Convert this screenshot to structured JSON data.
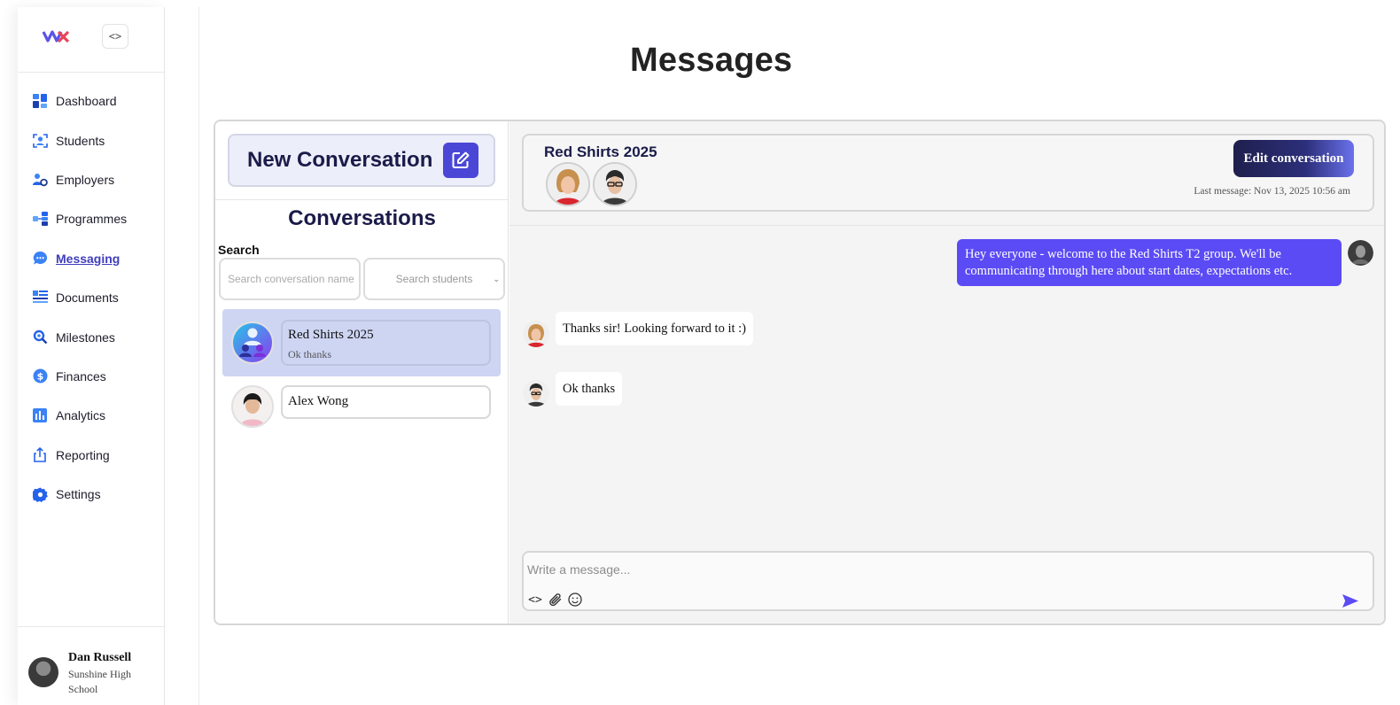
{
  "sidebar": {
    "collapse_label": "<>",
    "items": [
      {
        "label": "Dashboard",
        "icon": "dashboard-icon"
      },
      {
        "label": "Students",
        "icon": "students-icon"
      },
      {
        "label": "Employers",
        "icon": "employers-icon"
      },
      {
        "label": "Programmes",
        "icon": "programmes-icon"
      },
      {
        "label": "Messaging",
        "icon": "messaging-icon",
        "active": true
      },
      {
        "label": "Documents",
        "icon": "documents-icon"
      },
      {
        "label": "Milestones",
        "icon": "milestones-icon"
      },
      {
        "label": "Finances",
        "icon": "finances-icon"
      },
      {
        "label": "Analytics",
        "icon": "analytics-icon"
      },
      {
        "label": "Reporting",
        "icon": "reporting-icon"
      },
      {
        "label": "Settings",
        "icon": "settings-icon"
      }
    ],
    "user": {
      "name": "Dan Russell",
      "school": "Sunshine High School"
    }
  },
  "page": {
    "title": "Messages"
  },
  "left_pane": {
    "new_conversation_label": "New Conversation",
    "conversations_heading": "Conversations",
    "search_label": "Search",
    "search_placeholder": "Search conversation name",
    "student_select_placeholder": "Search students",
    "conversations": [
      {
        "name": "Red Shirts 2025",
        "last_message": "Ok thanks",
        "selected": true
      },
      {
        "name": "Alex Wong",
        "last_message": "",
        "selected": false
      }
    ]
  },
  "conversation": {
    "title": "Red Shirts 2025",
    "edit_label": "Edit conversation",
    "last_message_text": "Last message: Nov 13, 2025 10:56 am",
    "messages": [
      {
        "direction": "out",
        "text": "Hey everyone - welcome to the Red Shirts T2 group. We'll be communicating through here about start dates, expectations etc."
      },
      {
        "direction": "in",
        "text": "Thanks sir! Looking forward to it :)"
      },
      {
        "direction": "in",
        "text": "Ok thanks"
      }
    ],
    "composer_placeholder": "Write a message...",
    "code_label": "<>"
  },
  "colors": {
    "accent": "#4b47d6",
    "outgoing_bubble": "#5b4bf4",
    "selected_row": "#cdd5f3",
    "heading": "#1b1b4a"
  }
}
